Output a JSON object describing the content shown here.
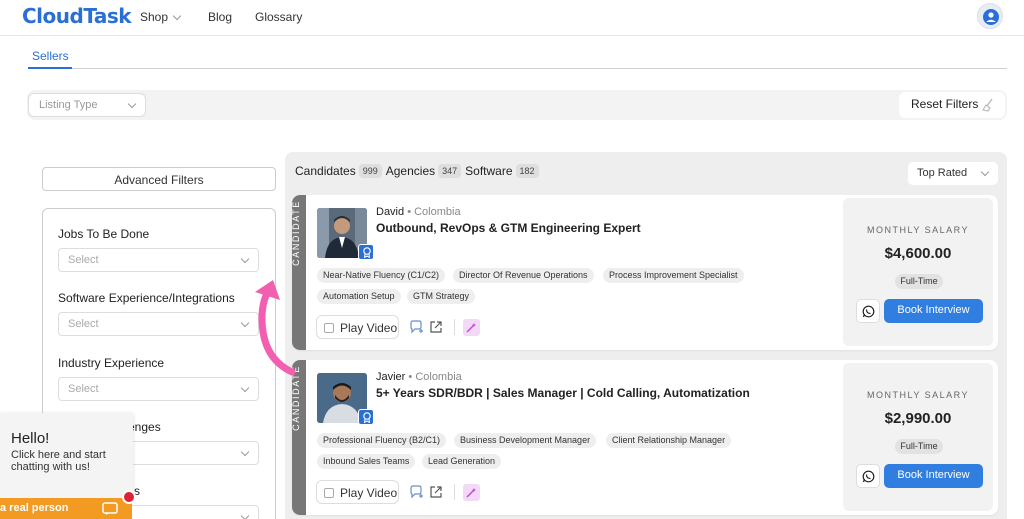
{
  "nav": {
    "logo": "CloudTask",
    "links": [
      "Shop",
      "Blog",
      "Glossary"
    ]
  },
  "tabs": {
    "active": "Sellers"
  },
  "filterbar": {
    "listing_type_placeholder": "Listing Type",
    "reset_label": "Reset Filters"
  },
  "sidebar": {
    "advanced_filters": "Advanced Filters",
    "filters": [
      {
        "label": "Jobs To Be Done",
        "placeholder": "Select"
      },
      {
        "label": "Software Experience/Integrations",
        "placeholder": "Select"
      },
      {
        "label": "Industry Experience",
        "placeholder": "Select"
      },
      {
        "label": "enges",
        "placeholder": ""
      },
      {
        "label": "s",
        "placeholder": ""
      }
    ]
  },
  "chat": {
    "hello": "Hello!",
    "text": "Click here and start chatting with us!",
    "bar": "a real person"
  },
  "results": {
    "tabs": [
      {
        "label": "Candidates",
        "count": "999"
      },
      {
        "label": "Agencies",
        "count": "347"
      },
      {
        "label": "Software",
        "count": "182"
      }
    ],
    "sort": "Top Rated"
  },
  "cards": [
    {
      "vlabel": "CANDIDATE",
      "name": "David",
      "country": "• Colombia",
      "title": "Outbound, RevOps & GTM Engineering Expert",
      "tags": [
        "Near-Native Fluency (C1/C2)",
        "Director Of Revenue Operations",
        "Process Improvement Specialist",
        "Automation Setup",
        "GTM Strategy"
      ],
      "play": "Play Video",
      "salary_label": "MONTHLY SALARY",
      "salary": "$4,600.00",
      "type": "Full-Time",
      "book": "Book Interview"
    },
    {
      "vlabel": "CANDIDATE",
      "name": "Javier",
      "country": "• Colombia",
      "title": "5+ Years SDR/BDR | Sales Manager | Cold Calling, Automatization",
      "tags": [
        "Professional Fluency (B2/C1)",
        "Business Development Manager",
        "Client Relationship Manager",
        "Inbound Sales Teams",
        "Lead Generation"
      ],
      "play": "Play Video",
      "salary_label": "MONTHLY SALARY",
      "salary": "$2,990.00",
      "type": "Full-Time",
      "book": "Book Interview"
    }
  ],
  "colors": {
    "brand": "#2a6fd6",
    "book_button": "#2f7ee0",
    "arrow": "#f25fb0",
    "chat_bar": "#f29a21"
  }
}
